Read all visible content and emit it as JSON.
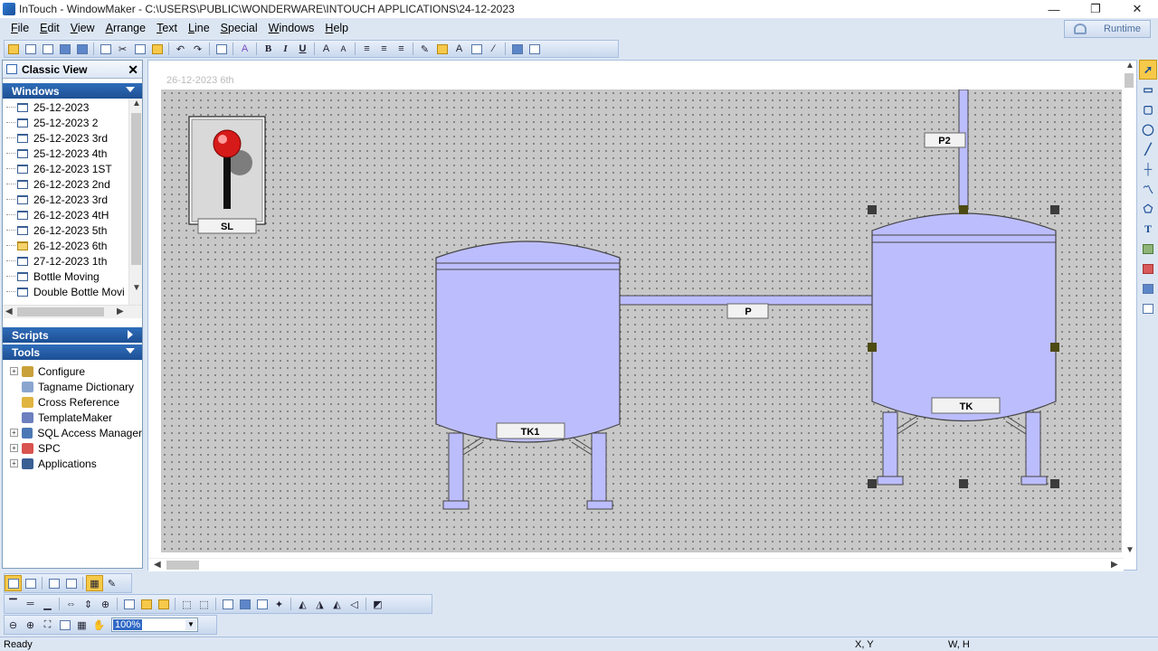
{
  "window": {
    "title": "InTouch - WindowMaker - C:\\USERS\\PUBLIC\\WONDERWARE\\INTOUCH APPLICATIONS\\24-12-2023",
    "minimize": "—",
    "restore": "❐",
    "close": "✕"
  },
  "menu": [
    "File",
    "Edit",
    "View",
    "Arrange",
    "Text",
    "Line",
    "Special",
    "Windows",
    "Help"
  ],
  "runtime_label": "Runtime",
  "classic_view": {
    "title": "Classic View",
    "close": "✕",
    "windows_header": "Windows",
    "windows": [
      {
        "label": "25-12-2023",
        "open": false
      },
      {
        "label": "25-12-2023 2",
        "open": false
      },
      {
        "label": "25-12-2023 3rd",
        "open": false
      },
      {
        "label": "25-12-2023 4th",
        "open": false
      },
      {
        "label": "26-12-2023 1ST",
        "open": false
      },
      {
        "label": "26-12-2023 2nd",
        "open": false
      },
      {
        "label": "26-12-2023 3rd",
        "open": false
      },
      {
        "label": "26-12-2023 4tH",
        "open": false
      },
      {
        "label": "26-12-2023 5th",
        "open": false
      },
      {
        "label": "26-12-2023 6th",
        "open": true
      },
      {
        "label": "27-12-2023 1th",
        "open": false
      },
      {
        "label": "Bottle Moving",
        "open": false
      },
      {
        "label": "Double Bottle Movi",
        "open": false
      }
    ],
    "scripts_header": "Scripts",
    "tools_header": "Tools",
    "tools": [
      {
        "label": "Configure",
        "expandable": true,
        "icon": "wrench-icon",
        "color": "#c9a13a"
      },
      {
        "label": "Tagname Dictionary",
        "expandable": false,
        "icon": "tag-icon",
        "color": "#8aa6cf"
      },
      {
        "label": "Cross Reference",
        "expandable": false,
        "icon": "cross-reference-icon",
        "color": "#e0b440"
      },
      {
        "label": "TemplateMaker",
        "expandable": false,
        "icon": "template-icon",
        "color": "#6c7fbf"
      },
      {
        "label": "SQL Access Manager",
        "expandable": true,
        "icon": "database-icon",
        "color": "#4b78b5"
      },
      {
        "label": "SPC",
        "expandable": true,
        "icon": "spc-icon",
        "color": "#d9534f"
      },
      {
        "label": "Applications",
        "expandable": true,
        "icon": "applications-icon",
        "color": "#3a5f95"
      }
    ]
  },
  "canvas": {
    "window_name": "26-12-2023 6th",
    "switch_label": "SL",
    "tank1_label": "TK1",
    "tank2_label": "TK",
    "pipe_label": "P",
    "pipe2_label": "P2",
    "tank_color": "#bcbdfd"
  },
  "zoom": "100%",
  "status": {
    "text": "Ready",
    "xy": "X, Y",
    "wh": "W, H"
  }
}
